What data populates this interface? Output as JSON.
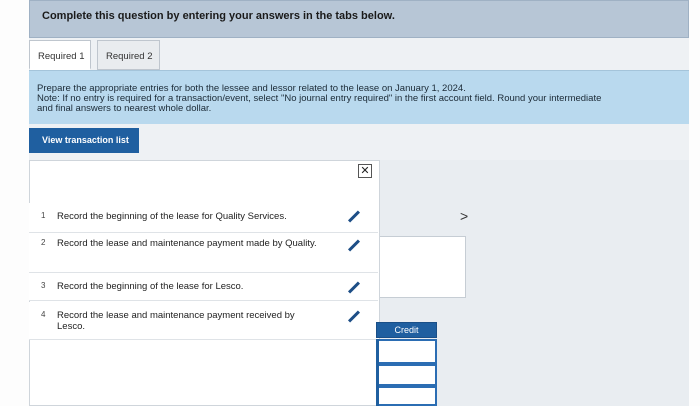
{
  "header": {
    "title": "Complete this question by entering your answers in the tabs below."
  },
  "tabs": [
    {
      "label": "Required 1"
    },
    {
      "label": "Required 2"
    }
  ],
  "instructions": {
    "line1": "Prepare the appropriate entries for both the lessee and lessor related to the lease on January 1, 2024.",
    "line2": "Note: If no entry is required for a transaction/event, select \"No journal entry required\" in the first account field. Round your intermediate",
    "line3": "and final answers to nearest whole dollar."
  },
  "view_button": {
    "label": "View transaction list"
  },
  "transactions": [
    {
      "num": "1",
      "text": "Record the beginning of the lease for Quality Services."
    },
    {
      "num": "2",
      "text": "Record the lease and maintenance payment made by Quality."
    },
    {
      "num": "3",
      "text": "Record the beginning of the lease for Lesco."
    },
    {
      "num": "4",
      "text": "Record the lease and maintenance payment received by Lesco."
    }
  ],
  "close_glyph": "✕",
  "next_glyph": ">",
  "journal": {
    "credit_header": "Credit"
  },
  "colors": {
    "accent": "#1f5fa0",
    "instruction_bg": "#b9d9ee",
    "header_bg": "#b7c6d6"
  },
  "icons": {
    "edit": "pencil-icon",
    "close": "close-icon",
    "next": "chevron-right-icon"
  }
}
